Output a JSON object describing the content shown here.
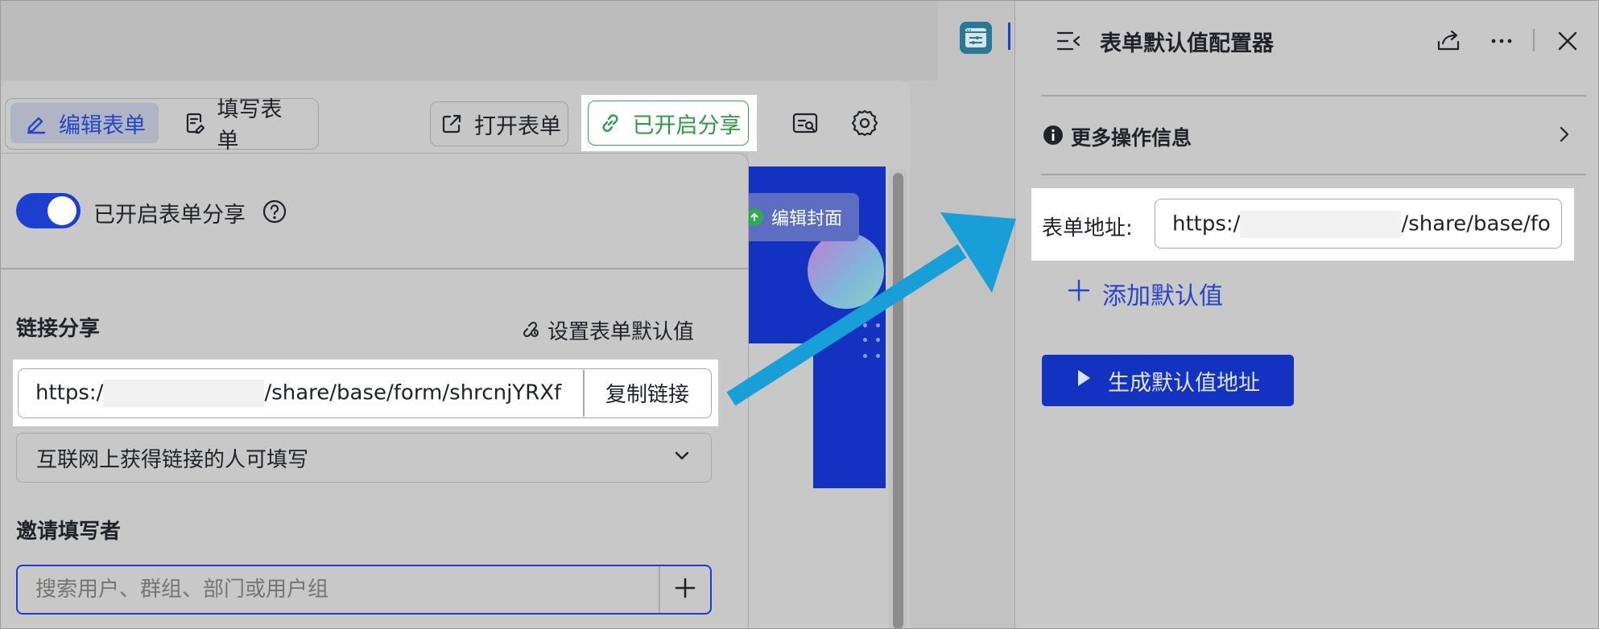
{
  "toolbar": {
    "edit_form": "编辑表单",
    "fill_form": "填写表单",
    "open_form": "打开表单",
    "share_enabled": "已开启分享"
  },
  "preview": {
    "edit_cover": "编辑封面"
  },
  "share_panel": {
    "toggle_label": "已开启表单分享",
    "link_share_title": "链接分享",
    "set_defaults": "设置表单默认值",
    "url_prefix": "https:/",
    "url_suffix": "/share/base/form/shrcnjYRXf",
    "copy_link": "复制链接",
    "permission": "互联网上获得链接的人可填写",
    "invite_title": "邀请填写者",
    "search_placeholder": "搜索用户、群组、部门或用户组"
  },
  "config_panel": {
    "title": "表单默认值配置器",
    "more_info": "更多操作信息",
    "address_label": "表单地址:",
    "address_prefix": "https:/",
    "address_suffix": "/share/base/for",
    "add_default": "添加默认值",
    "generate": "生成默认值地址"
  },
  "colors": {
    "accent_blue": "#1c3fd0",
    "share_green": "#34a853",
    "arrow_blue": "#189fd8"
  },
  "icons": [
    "edit-icon",
    "fill-form-icon",
    "external-link-icon",
    "link-icon",
    "preview-icon",
    "gear-icon",
    "help-icon",
    "config-icon",
    "collapse-icon",
    "share-icon",
    "more-icon",
    "close-icon",
    "info-icon",
    "chevron-right-icon",
    "chevron-down-icon",
    "plus-icon",
    "play-icon",
    "arrow-up-icon",
    "annotation-arrow"
  ]
}
